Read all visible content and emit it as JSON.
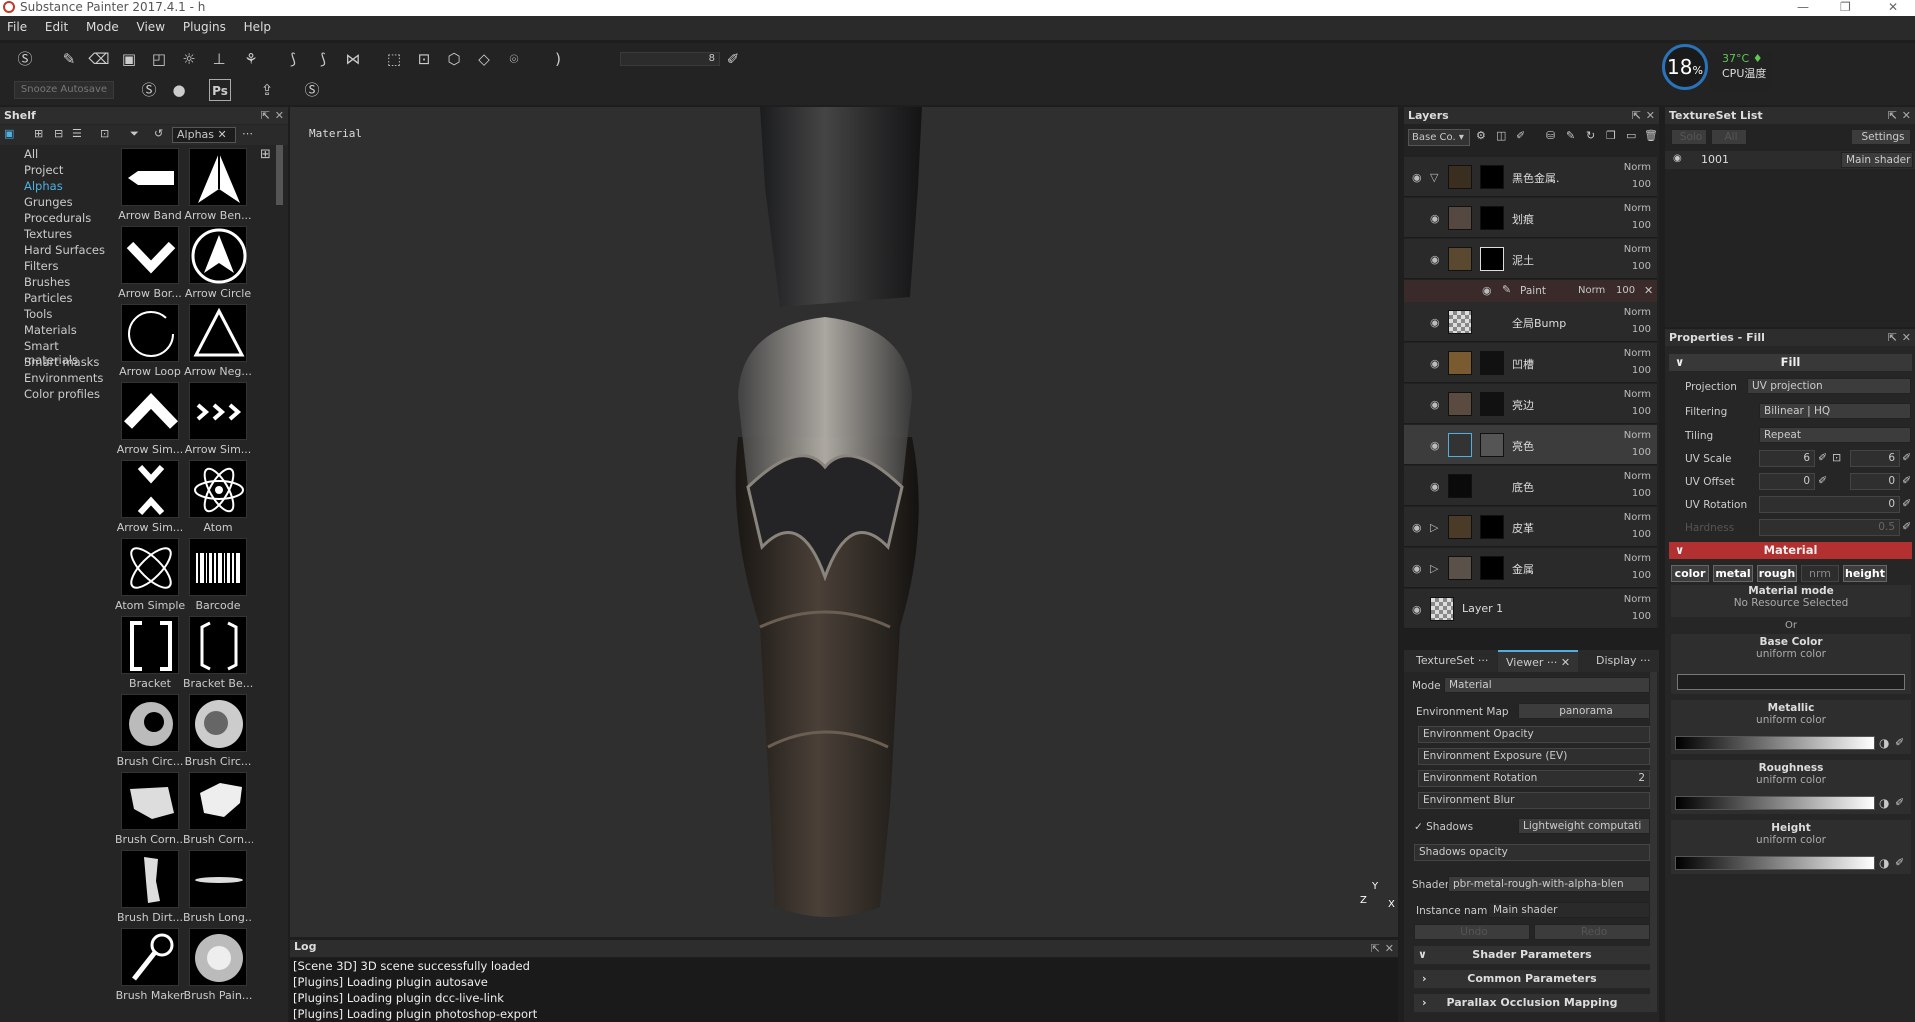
{
  "window": {
    "title": "Substance Painter 2017.4.1 - h"
  },
  "menu": [
    "File",
    "Edit",
    "Mode",
    "View",
    "Plugins",
    "Help"
  ],
  "toolbar": {
    "snooze": "Snooze Autosave",
    "brush_value": "8"
  },
  "cpu": {
    "usage": "18",
    "unit": "%",
    "temp": "37°C",
    "label": "CPU温度"
  },
  "shelf": {
    "title": "Shelf",
    "filter": "Alphas",
    "categories": [
      "All",
      "Project",
      "Alphas",
      "Grunges",
      "Procedurals",
      "Textures",
      "Hard Surfaces",
      "Filters",
      "Brushes",
      "Particles",
      "Tools",
      "Materials",
      "Smart materials",
      "Smart masks",
      "Environments",
      "Color profiles"
    ],
    "items": [
      "Arrow Band",
      "Arrow Ben...",
      "Arrow Bor...",
      "Arrow Circle",
      "Arrow Loop",
      "Arrow Neg...",
      "Arrow Sim...",
      "Arrow Sim...",
      "Arrow Sim...",
      "Atom",
      "Atom Simple",
      "Barcode",
      "Bracket",
      "Bracket Be...",
      "Brush Circ...",
      "Brush Circ...",
      "Brush Corn...",
      "Brush Corn...",
      "Brush Dirt...",
      "Brush Long...",
      "Brush Maker",
      "Brush Pain..."
    ]
  },
  "viewport": {
    "label": "Material",
    "axis_y": "Y",
    "axis_x": "X",
    "axis_z": "Z"
  },
  "layers": {
    "title": "Layers",
    "channel": "Base Co.",
    "rows": [
      {
        "name": "黑色金属.",
        "blend": "Norm",
        "opacity": "100"
      },
      {
        "name": "划痕",
        "blend": "Norm",
        "opacity": "100"
      },
      {
        "name": "泥土",
        "blend": "Norm",
        "opacity": "100"
      },
      {
        "name": "全局Bump",
        "blend": "Norm",
        "opacity": "100"
      },
      {
        "name": "凹槽",
        "blend": "Norm",
        "opacity": "100"
      },
      {
        "name": "亮边",
        "blend": "Norm",
        "opacity": "100"
      },
      {
        "name": "亮色",
        "blend": "Norm",
        "opacity": "100"
      },
      {
        "name": "底色",
        "blend": "Norm",
        "opacity": "100"
      },
      {
        "name": "皮革",
        "blend": "Norm",
        "opacity": "100"
      },
      {
        "name": "金属",
        "blend": "Norm",
        "opacity": "100"
      },
      {
        "name": "Layer 1",
        "blend": "Norm",
        "opacity": "100"
      }
    ],
    "paint": {
      "name": "Paint",
      "blend": "Norm",
      "opacity": "100"
    }
  },
  "viewer_panel": {
    "tabs": [
      "TextureSet ···",
      "Viewer ···",
      "Display ···"
    ],
    "mode_label": "Mode",
    "mode_value": "Material",
    "envmap_label": "Environment Map",
    "envmap_value": "panorama",
    "env_opacity": "Environment Opacity",
    "env_exposure": "Environment Exposure (EV)",
    "env_rotation": "Environment Rotation",
    "env_rotation_value": "2",
    "env_blur": "Environment Blur",
    "shadows": "Shadows",
    "shadows_mode": "Lightweight computati",
    "shadows_opacity": "Shadows opacity",
    "shader_label": "Shader",
    "shader_value": "pbr-metal-rough-with-alpha-blen",
    "instance_label": "Instance name",
    "instance_value": "Main shader",
    "undo": "Undo",
    "redo": "Redo",
    "sections": [
      "Shader Parameters",
      "Common Parameters",
      "Parallax Occlusion Mapping"
    ]
  },
  "textureset": {
    "title": "TextureSet List",
    "solo": "Solo",
    "all": "All",
    "settings": "Settings",
    "item": "1001",
    "shader": "Main shader"
  },
  "properties": {
    "title": "Properties - Fill",
    "fill": "Fill",
    "projection_label": "Projection",
    "projection": "UV projection",
    "filtering_label": "Filtering",
    "filtering": "Bilinear | HQ",
    "tiling_label": "Tiling",
    "tiling": "Repeat",
    "uvscale_label": "UV Scale",
    "uvscale_a": "6",
    "uvscale_b": "6",
    "uvoffset_label": "UV Offset",
    "uvoffset_a": "0",
    "uvoffset_b": "0",
    "uvrotation_label": "UV Rotation",
    "uvrotation": "0",
    "hardness_label": "Hardness",
    "hardness": "0.5",
    "material": "Material",
    "channels": [
      "color",
      "metal",
      "rough",
      "nrm",
      "height"
    ],
    "material_mode": "Material mode",
    "no_resource": "No Resource Selected",
    "or": "Or",
    "base_color": "Base Color",
    "uniform": "uniform color",
    "metallic": "Metallic",
    "roughness": "Roughness",
    "height": "Height"
  },
  "log": {
    "title": "Log",
    "lines": [
      "[Scene 3D] 3D scene successfully loaded",
      "[Plugins] Loading plugin autosave",
      "[Plugins] Loading plugin dcc-live-link",
      "[Plugins] Loading plugin photoshop-export"
    ]
  },
  "colors": {
    "accent": "#4fb0e0",
    "material_header": "#b23030"
  }
}
